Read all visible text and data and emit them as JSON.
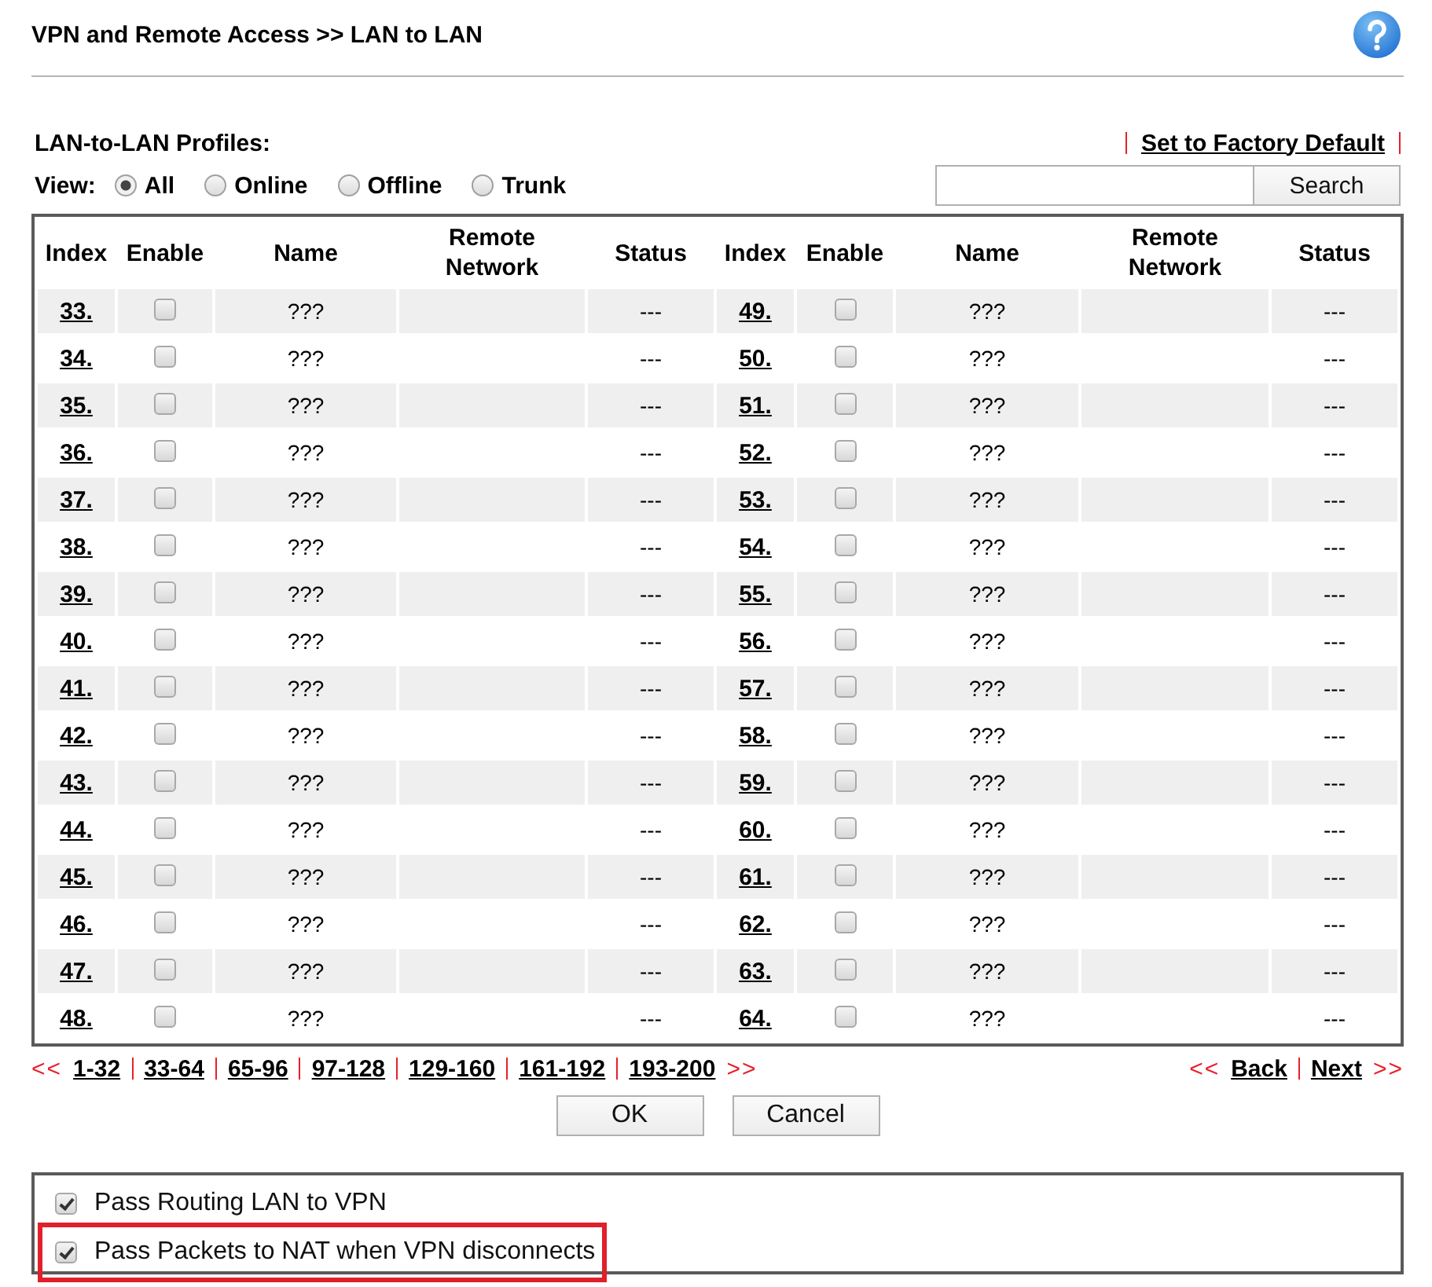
{
  "page": {
    "title": "VPN and Remote Access >> LAN to LAN"
  },
  "profiles": {
    "title": "LAN-to-LAN Profiles:",
    "factory_default_link": "Set to Factory Default",
    "view_label": "View:",
    "view_options": [
      {
        "label": "All",
        "selected": true
      },
      {
        "label": "Online",
        "selected": false
      },
      {
        "label": "Offline",
        "selected": false
      },
      {
        "label": "Trunk",
        "selected": false
      }
    ],
    "search_button": "Search"
  },
  "table": {
    "columns": [
      "Index",
      "Enable",
      "Name",
      "Remote Network",
      "Status",
      "Index",
      "Enable",
      "Name",
      "Remote Network",
      "Status"
    ],
    "rows": [
      [
        {
          "index": "33.",
          "enabled": false,
          "name": "???",
          "status": "---"
        },
        {
          "index": "49.",
          "enabled": false,
          "name": "???",
          "status": "---"
        }
      ],
      [
        {
          "index": "34.",
          "enabled": false,
          "name": "???",
          "status": "---"
        },
        {
          "index": "50.",
          "enabled": false,
          "name": "???",
          "status": "---"
        }
      ],
      [
        {
          "index": "35.",
          "enabled": false,
          "name": "???",
          "status": "---"
        },
        {
          "index": "51.",
          "enabled": false,
          "name": "???",
          "status": "---"
        }
      ],
      [
        {
          "index": "36.",
          "enabled": false,
          "name": "???",
          "status": "---"
        },
        {
          "index": "52.",
          "enabled": false,
          "name": "???",
          "status": "---"
        }
      ],
      [
        {
          "index": "37.",
          "enabled": false,
          "name": "???",
          "status": "---"
        },
        {
          "index": "53.",
          "enabled": false,
          "name": "???",
          "status": "---"
        }
      ],
      [
        {
          "index": "38.",
          "enabled": false,
          "name": "???",
          "status": "---"
        },
        {
          "index": "54.",
          "enabled": false,
          "name": "???",
          "status": "---"
        }
      ],
      [
        {
          "index": "39.",
          "enabled": false,
          "name": "???",
          "status": "---"
        },
        {
          "index": "55.",
          "enabled": false,
          "name": "???",
          "status": "---"
        }
      ],
      [
        {
          "index": "40.",
          "enabled": false,
          "name": "???",
          "status": "---"
        },
        {
          "index": "56.",
          "enabled": false,
          "name": "???",
          "status": "---"
        }
      ],
      [
        {
          "index": "41.",
          "enabled": false,
          "name": "???",
          "status": "---"
        },
        {
          "index": "57.",
          "enabled": false,
          "name": "???",
          "status": "---"
        }
      ],
      [
        {
          "index": "42.",
          "enabled": false,
          "name": "???",
          "status": "---"
        },
        {
          "index": "58.",
          "enabled": false,
          "name": "???",
          "status": "---"
        }
      ],
      [
        {
          "index": "43.",
          "enabled": false,
          "name": "???",
          "status": "---"
        },
        {
          "index": "59.",
          "enabled": false,
          "name": "???",
          "status": "---"
        }
      ],
      [
        {
          "index": "44.",
          "enabled": false,
          "name": "???",
          "status": "---"
        },
        {
          "index": "60.",
          "enabled": false,
          "name": "???",
          "status": "---"
        }
      ],
      [
        {
          "index": "45.",
          "enabled": false,
          "name": "???",
          "status": "---"
        },
        {
          "index": "61.",
          "enabled": false,
          "name": "???",
          "status": "---"
        }
      ],
      [
        {
          "index": "46.",
          "enabled": false,
          "name": "???",
          "status": "---"
        },
        {
          "index": "62.",
          "enabled": false,
          "name": "???",
          "status": "---"
        }
      ],
      [
        {
          "index": "47.",
          "enabled": false,
          "name": "???",
          "status": "---"
        },
        {
          "index": "63.",
          "enabled": false,
          "name": "???",
          "status": "---"
        }
      ],
      [
        {
          "index": "48.",
          "enabled": false,
          "name": "???",
          "status": "---"
        },
        {
          "index": "64.",
          "enabled": false,
          "name": "???",
          "status": "---"
        }
      ]
    ]
  },
  "pagination": {
    "first_mark": "<<",
    "pages": [
      "1-32",
      "33-64",
      "65-96",
      "97-128",
      "129-160",
      "161-192",
      "193-200"
    ],
    "last_mark": ">>",
    "back_mark": "<<",
    "back": "Back",
    "next": "Next",
    "next_mark": ">>"
  },
  "buttons": [
    "OK",
    "Cancel"
  ],
  "options": [
    {
      "label": "Pass Routing LAN to VPN",
      "checked": true,
      "highlighted": false
    },
    {
      "label": "Pass Packets to NAT when VPN disconnects",
      "checked": true,
      "highlighted": true
    }
  ]
}
